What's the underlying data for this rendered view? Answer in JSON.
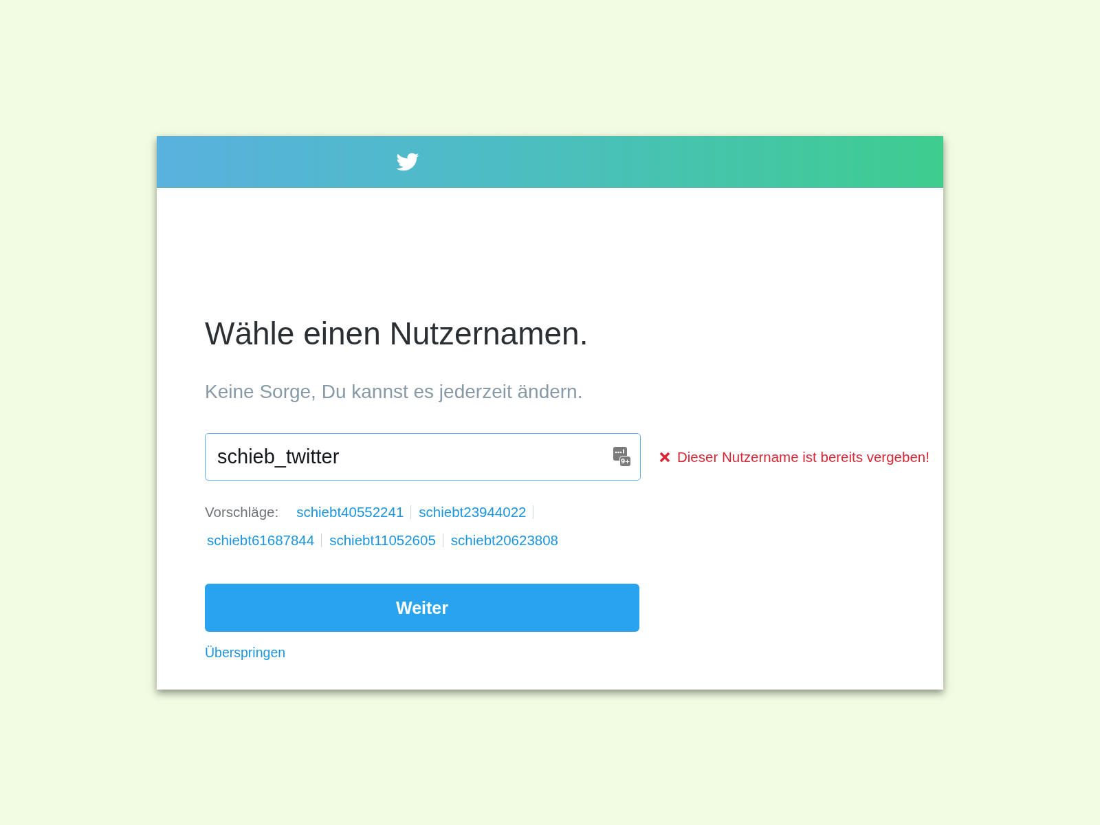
{
  "heading": "Wähle einen Nutzernamen.",
  "subtitle": "Keine Sorge, Du kannst es jederzeit ändern.",
  "username_field": {
    "value": "schieb_twitter",
    "focused": true,
    "autofill_badge": "9+"
  },
  "error": {
    "text": "Dieser Nutzername ist bereits vergeben!"
  },
  "suggestions": {
    "label": "Vorschläge:",
    "items": [
      "schiebt40552241",
      "schiebt23944022",
      "schiebt61687844",
      "schiebt11052605",
      "schiebt20623808"
    ]
  },
  "primary_button": "Weiter",
  "skip_link": "Überspringen"
}
